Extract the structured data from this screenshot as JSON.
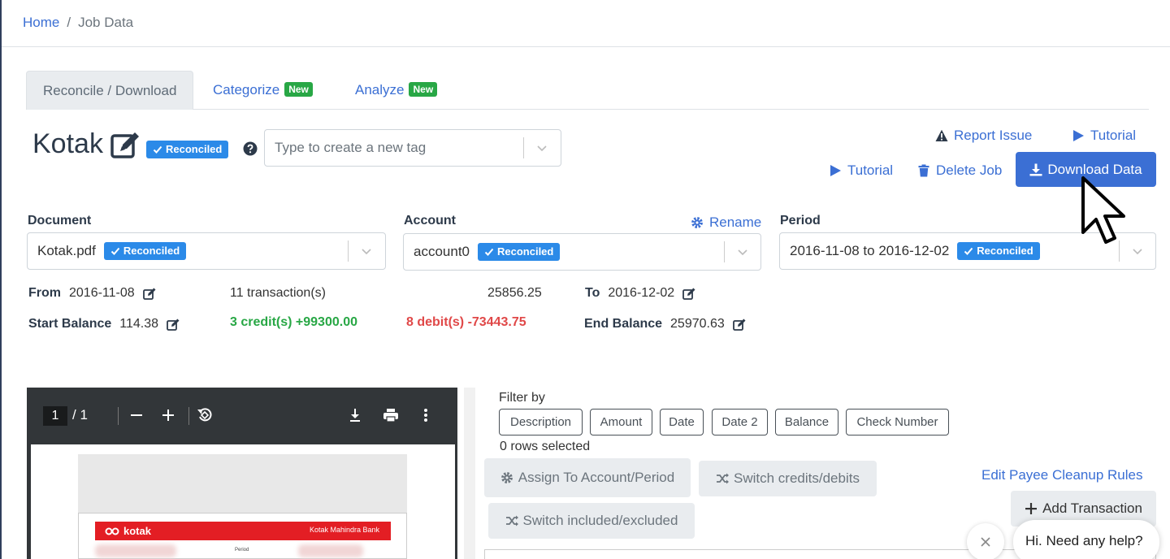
{
  "breadcrumb": {
    "home": "Home",
    "separator": "/",
    "current": "Job Data"
  },
  "tabs": [
    {
      "label": "Reconcile / Download",
      "active": true
    },
    {
      "label": "Categorize",
      "badge": "New"
    },
    {
      "label": "Analyze",
      "badge": "New"
    }
  ],
  "job": {
    "title": "Kotak",
    "status_badge": "Reconciled",
    "tag_placeholder": "Type to create a new tag"
  },
  "actions": {
    "report_issue": "Report Issue",
    "tutorial_top": "Tutorial",
    "tutorial": "Tutorial",
    "delete_job": "Delete Job",
    "download_data": "Download Data"
  },
  "document": {
    "label": "Document",
    "value": "Kotak.pdf",
    "badge": "Reconciled"
  },
  "account": {
    "label": "Account",
    "rename": "Rename",
    "value": "account0",
    "badge": "Reconciled"
  },
  "period": {
    "label": "Period",
    "value": "2016-11-08 to 2016-12-02",
    "badge": "Reconciled"
  },
  "summary": {
    "from_label": "From",
    "from_value": "2016-11-08",
    "transactions": "11 transaction(s)",
    "total": "25856.25",
    "to_label": "To",
    "to_value": "2016-12-02",
    "start_balance_label": "Start Balance",
    "start_balance_value": "114.38",
    "credits": "3 credit(s) +99300.00",
    "debits": "8 debit(s) -73443.75",
    "end_balance_label": "End Balance",
    "end_balance_value": "25970.63"
  },
  "pdf_viewer": {
    "page": "1",
    "total_pages": "/ 1",
    "bank_logo": "kotak",
    "bank_name": "Kotak Mahindra Bank",
    "period_label": "Period"
  },
  "transactions_panel": {
    "filter_label": "Filter by",
    "filters": [
      "Description",
      "Amount",
      "Date",
      "Date 2",
      "Balance",
      "Check Number"
    ],
    "rows_selected": "0 rows selected",
    "assign_button": "Assign To Account/Period",
    "switch_credits_button": "Switch credits/debits",
    "switch_included_button": "Switch included/excluded",
    "edit_payee_link": "Edit Payee Cleanup Rules",
    "add_transaction_button": "Add Transaction"
  },
  "chat": {
    "message": "Hi. Need any help?"
  },
  "colors": {
    "primary": "#3b6fd4",
    "badge_blue": "#2b8ae8",
    "credit": "#28a745",
    "debit": "#e04848",
    "new_badge": "#28a745"
  }
}
